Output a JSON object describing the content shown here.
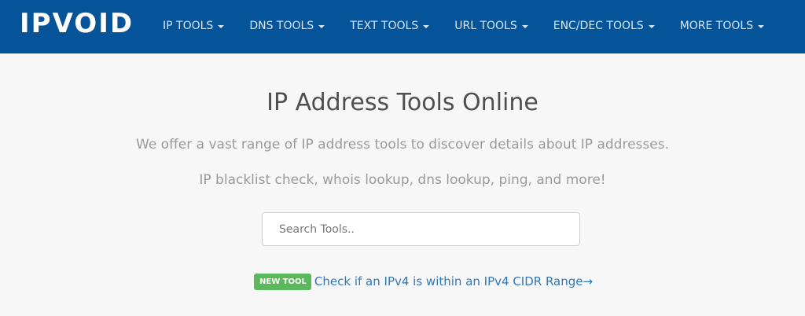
{
  "navbar": {
    "brand": "IPVOID",
    "items": [
      {
        "label": "IP TOOLS"
      },
      {
        "label": "DNS TOOLS"
      },
      {
        "label": "TEXT TOOLS"
      },
      {
        "label": "URL TOOLS"
      },
      {
        "label": "ENC/DEC TOOLS"
      },
      {
        "label": "MORE TOOLS"
      }
    ]
  },
  "hero": {
    "title": "IP Address Tools Online",
    "lead_1": "We offer a vast range of IP address tools to discover details about IP addresses.",
    "lead_2": "IP blacklist check, whois lookup, dns lookup, ping, and more!",
    "search_placeholder": "Search Tools..",
    "search_value": "",
    "new_tool_badge": "NEW TOOL",
    "new_tool_link": "Check if an IPv4 is within an IPv4 CIDR Range→"
  },
  "colors": {
    "navbar_bg": "#05549a",
    "nav_text": "#d6e7f7",
    "page_bg": "#f7f7f7",
    "title_text": "#4f4f4f",
    "lead_text": "#9a9a9a",
    "badge_bg": "#5cb85c",
    "link": "#2f78b7"
  },
  "icons": {
    "nav_dropdown": "caret-down-icon"
  }
}
